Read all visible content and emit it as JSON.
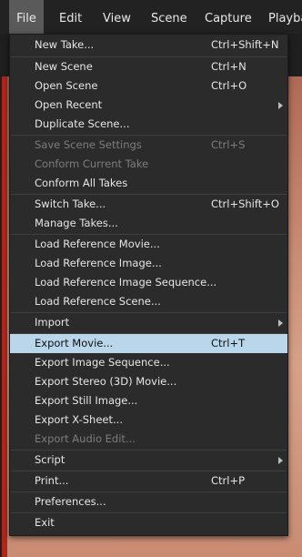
{
  "menubar": {
    "items": [
      "File",
      "Edit",
      "View",
      "Scene",
      "Capture",
      "Playba"
    ]
  },
  "file_menu": {
    "items": [
      {
        "label": "New Take...",
        "shortcut": "Ctrl+Shift+N"
      },
      {
        "label": "New Scene",
        "shortcut": "Ctrl+N"
      },
      {
        "label": "Open Scene",
        "shortcut": "Ctrl+O"
      },
      {
        "label": "Open Recent",
        "shortcut": ""
      },
      {
        "label": "Duplicate Scene...",
        "shortcut": ""
      },
      {
        "label": "Save Scene Settings",
        "shortcut": "Ctrl+S"
      },
      {
        "label": "Conform Current Take",
        "shortcut": ""
      },
      {
        "label": "Conform All Takes",
        "shortcut": ""
      },
      {
        "label": "Switch Take...",
        "shortcut": "Ctrl+Shift+O"
      },
      {
        "label": "Manage Takes...",
        "shortcut": ""
      },
      {
        "label": "Load Reference Movie...",
        "shortcut": ""
      },
      {
        "label": "Load Reference Image...",
        "shortcut": ""
      },
      {
        "label": "Load Reference Image Sequence...",
        "shortcut": ""
      },
      {
        "label": "Load Reference Scene...",
        "shortcut": ""
      },
      {
        "label": "Import",
        "shortcut": ""
      },
      {
        "label": "Export Movie...",
        "shortcut": "Ctrl+T"
      },
      {
        "label": "Export Image Sequence...",
        "shortcut": ""
      },
      {
        "label": "Export Stereo (3D) Movie...",
        "shortcut": ""
      },
      {
        "label": "Export Still Image...",
        "shortcut": ""
      },
      {
        "label": "Export X-Sheet...",
        "shortcut": ""
      },
      {
        "label": "Export Audio Edit...",
        "shortcut": ""
      },
      {
        "label": "Script",
        "shortcut": ""
      },
      {
        "label": "Print...",
        "shortcut": "Ctrl+P"
      },
      {
        "label": "Preferences...",
        "shortcut": ""
      },
      {
        "label": "Exit",
        "shortcut": ""
      }
    ]
  },
  "colors": {
    "menu_bg": "#2b2b2b",
    "highlight": "#b9d6ea",
    "disabled_text": "#7d7d7d",
    "menubar_active": "#5a5a5a"
  }
}
